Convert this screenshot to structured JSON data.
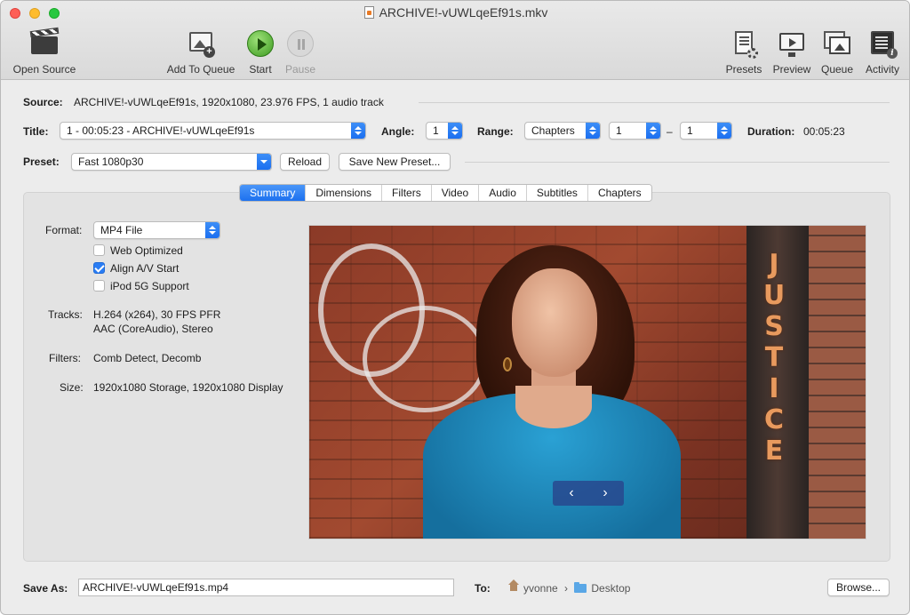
{
  "window": {
    "title": "ARCHIVE!-vUWLqeEf91s.mkv"
  },
  "toolbar": {
    "open_source": "Open Source",
    "add_to_queue": "Add To Queue",
    "start": "Start",
    "pause": "Pause",
    "presets": "Presets",
    "preview": "Preview",
    "queue": "Queue",
    "activity": "Activity"
  },
  "source": {
    "label": "Source:",
    "value": "ARCHIVE!-vUWLqeEf91s, 1920x1080, 23.976 FPS, 1 audio track"
  },
  "title_row": {
    "title_label": "Title:",
    "title_value": "1 - 00:05:23 - ARCHIVE!-vUWLqeEf91s",
    "angle_label": "Angle:",
    "angle_value": "1",
    "range_label": "Range:",
    "range_type": "Chapters",
    "range_start": "1",
    "range_dash": "–",
    "range_end": "1",
    "duration_label": "Duration:",
    "duration_value": "00:05:23"
  },
  "preset_row": {
    "label": "Preset:",
    "value": "Fast 1080p30",
    "reload": "Reload",
    "save_new": "Save New Preset..."
  },
  "tabs": [
    "Summary",
    "Dimensions",
    "Filters",
    "Video",
    "Audio",
    "Subtitles",
    "Chapters"
  ],
  "summary": {
    "format_label": "Format:",
    "format_value": "MP4 File",
    "web_optimized": "Web Optimized",
    "align_av": "Align A/V Start",
    "ipod": "iPod 5G Support",
    "tracks_label": "Tracks:",
    "tracks_line1": "H.264 (x264), 30 FPS PFR",
    "tracks_line2": "AAC (CoreAudio), Stereo",
    "filters_label": "Filters:",
    "filters_value": "Comb Detect, Decomb",
    "size_label": "Size:",
    "size_value": "1920x1080 Storage, 1920x1080 Display",
    "checkboxes": {
      "web_optimized": false,
      "align_av": true,
      "ipod": false
    }
  },
  "preview": {
    "sign_text": "JUSTICE",
    "prev": "‹",
    "next": "›"
  },
  "bottom": {
    "save_as_label": "Save As:",
    "save_as_value": "ARCHIVE!-vUWLqeEf91s.mp4",
    "to_label": "To:",
    "path_home": "yvonne",
    "path_sep": "›",
    "path_folder": "Desktop",
    "browse": "Browse..."
  }
}
